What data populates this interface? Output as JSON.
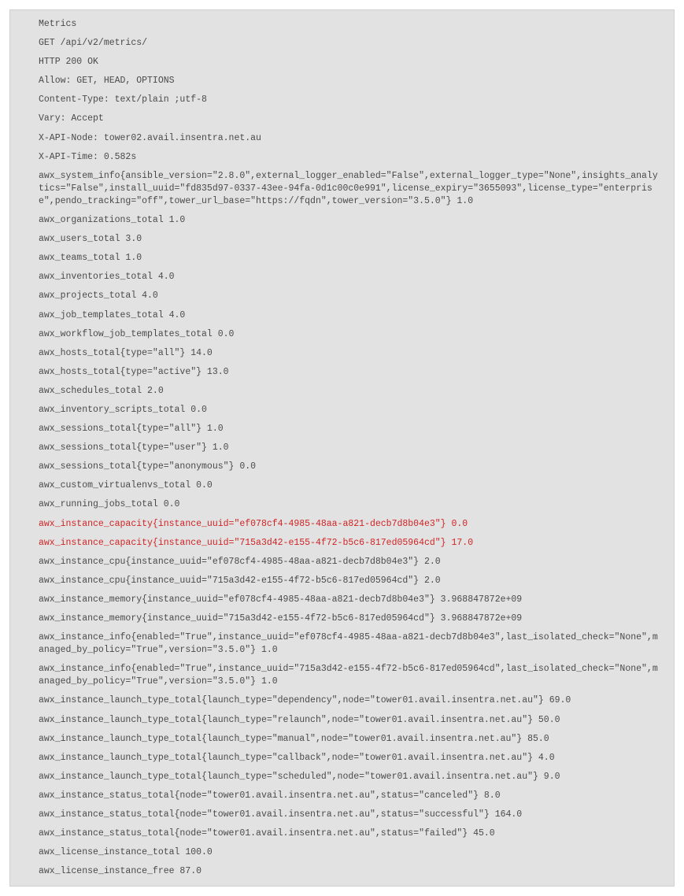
{
  "lines": [
    {
      "text": "Metrics",
      "highlight": false
    },
    {
      "text": "GET /api/v2/metrics/",
      "highlight": false
    },
    {
      "text": "HTTP 200 OK",
      "highlight": false
    },
    {
      "text": "Allow: GET, HEAD, OPTIONS",
      "highlight": false
    },
    {
      "text": "Content-Type: text/plain ;utf-8",
      "highlight": false
    },
    {
      "text": "Vary: Accept",
      "highlight": false
    },
    {
      "text": "X-API-Node: tower02.avail.insentra.net.au",
      "highlight": false
    },
    {
      "text": "X-API-Time: 0.582s",
      "highlight": false
    },
    {
      "text": "awx_system_info{ansible_version=\"2.8.0\",external_logger_enabled=\"False\",external_logger_type=\"None\",insights_analytics=\"False\",install_uuid=\"fd835d97-0337-43ee-94fa-0d1c00c0e991\",license_expiry=\"3655093\",license_type=\"enterprise\",pendo_tracking=\"off\",tower_url_base=\"https://fqdn\",tower_version=\"3.5.0\"} 1.0",
      "highlight": false
    },
    {
      "text": "awx_organizations_total 1.0",
      "highlight": false
    },
    {
      "text": "awx_users_total 3.0",
      "highlight": false
    },
    {
      "text": "awx_teams_total 1.0",
      "highlight": false
    },
    {
      "text": "awx_inventories_total 4.0",
      "highlight": false
    },
    {
      "text": "awx_projects_total 4.0",
      "highlight": false
    },
    {
      "text": "awx_job_templates_total 4.0",
      "highlight": false
    },
    {
      "text": "awx_workflow_job_templates_total 0.0",
      "highlight": false
    },
    {
      "text": "awx_hosts_total{type=\"all\"} 14.0",
      "highlight": false
    },
    {
      "text": "awx_hosts_total{type=\"active\"} 13.0",
      "highlight": false
    },
    {
      "text": "awx_schedules_total 2.0",
      "highlight": false
    },
    {
      "text": "awx_inventory_scripts_total 0.0",
      "highlight": false
    },
    {
      "text": "awx_sessions_total{type=\"all\"} 1.0",
      "highlight": false
    },
    {
      "text": "awx_sessions_total{type=\"user\"} 1.0",
      "highlight": false
    },
    {
      "text": "awx_sessions_total{type=\"anonymous\"} 0.0",
      "highlight": false
    },
    {
      "text": "awx_custom_virtualenvs_total 0.0",
      "highlight": false
    },
    {
      "text": "awx_running_jobs_total 0.0",
      "highlight": false
    },
    {
      "text": "awx_instance_capacity{instance_uuid=\"ef078cf4-4985-48aa-a821-decb7d8b04e3\"} 0.0",
      "highlight": true
    },
    {
      "text": "awx_instance_capacity{instance_uuid=\"715a3d42-e155-4f72-b5c6-817ed05964cd\"} 17.0",
      "highlight": true
    },
    {
      "text": "awx_instance_cpu{instance_uuid=\"ef078cf4-4985-48aa-a821-decb7d8b04e3\"} 2.0",
      "highlight": false
    },
    {
      "text": "awx_instance_cpu{instance_uuid=\"715a3d42-e155-4f72-b5c6-817ed05964cd\"} 2.0",
      "highlight": false
    },
    {
      "text": "awx_instance_memory{instance_uuid=\"ef078cf4-4985-48aa-a821-decb7d8b04e3\"} 3.968847872e+09",
      "highlight": false
    },
    {
      "text": "awx_instance_memory{instance_uuid=\"715a3d42-e155-4f72-b5c6-817ed05964cd\"} 3.968847872e+09",
      "highlight": false
    },
    {
      "text": "awx_instance_info{enabled=\"True\",instance_uuid=\"ef078cf4-4985-48aa-a821-decb7d8b04e3\",last_isolated_check=\"None\",managed_by_policy=\"True\",version=\"3.5.0\"} 1.0",
      "highlight": false
    },
    {
      "text": "awx_instance_info{enabled=\"True\",instance_uuid=\"715a3d42-e155-4f72-b5c6-817ed05964cd\",last_isolated_check=\"None\",managed_by_policy=\"True\",version=\"3.5.0\"} 1.0",
      "highlight": false
    },
    {
      "text": "awx_instance_launch_type_total{launch_type=\"dependency\",node=\"tower01.avail.insentra.net.au\"} 69.0",
      "highlight": false
    },
    {
      "text": "awx_instance_launch_type_total{launch_type=\"relaunch\",node=\"tower01.avail.insentra.net.au\"} 50.0",
      "highlight": false
    },
    {
      "text": "awx_instance_launch_type_total{launch_type=\"manual\",node=\"tower01.avail.insentra.net.au\"} 85.0",
      "highlight": false
    },
    {
      "text": "awx_instance_launch_type_total{launch_type=\"callback\",node=\"tower01.avail.insentra.net.au\"} 4.0",
      "highlight": false
    },
    {
      "text": "awx_instance_launch_type_total{launch_type=\"scheduled\",node=\"tower01.avail.insentra.net.au\"} 9.0",
      "highlight": false
    },
    {
      "text": "awx_instance_status_total{node=\"tower01.avail.insentra.net.au\",status=\"canceled\"} 8.0",
      "highlight": false
    },
    {
      "text": "awx_instance_status_total{node=\"tower01.avail.insentra.net.au\",status=\"successful\"} 164.0",
      "highlight": false
    },
    {
      "text": "awx_instance_status_total{node=\"tower01.avail.insentra.net.au\",status=\"failed\"} 45.0",
      "highlight": false
    },
    {
      "text": "awx_license_instance_total 100.0",
      "highlight": false
    },
    {
      "text": "awx_license_instance_free 87.0",
      "highlight": false
    }
  ]
}
